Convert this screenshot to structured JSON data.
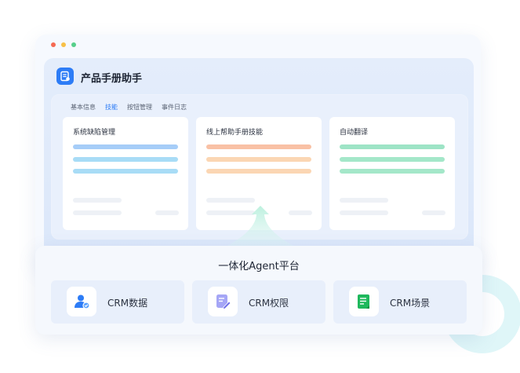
{
  "window": {
    "dot_colors": [
      "#f56a52",
      "#f7c047",
      "#56cf8a"
    ]
  },
  "app": {
    "title": "产品手册助手",
    "icon": "document-icon",
    "accent": "#2d7cf6"
  },
  "tabs": [
    {
      "label": "基本信息",
      "active": false
    },
    {
      "label": "技能",
      "active": true
    },
    {
      "label": "按钮管理",
      "active": false
    },
    {
      "label": "事件日志",
      "active": false
    }
  ],
  "skills": [
    {
      "title": "系统缺陷管理",
      "bar_colors": [
        "#a6cdf8",
        "#a8dcf6",
        "#a8dcf6"
      ]
    },
    {
      "title": "线上帮助手册技能",
      "bar_colors": [
        "#f9c1a5",
        "#fbd6b3",
        "#fbd6b3"
      ]
    },
    {
      "title": "自动翻译",
      "bar_colors": [
        "#9ee4c6",
        "#a4e7c9",
        "#a4e7c9"
      ]
    }
  ],
  "platform": {
    "title": "一体化Agent平台",
    "items": [
      {
        "label": "CRM数据",
        "icon": "user-icon",
        "color": "#2d7cf6"
      },
      {
        "label": "CRM权限",
        "icon": "edit-icon",
        "color": "#8c8cf2"
      },
      {
        "label": "CRM场景",
        "icon": "sheet-icon",
        "color": "#1fb85c"
      }
    ]
  }
}
